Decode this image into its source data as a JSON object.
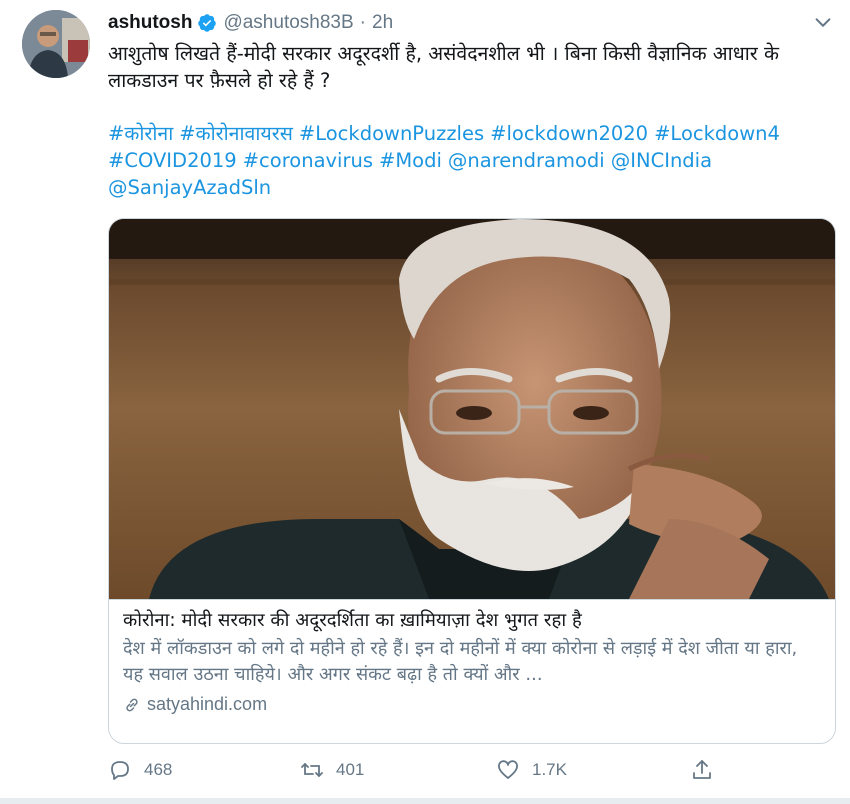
{
  "user": {
    "name": "ashutosh",
    "handle": "@ashutosh83B",
    "separator": "·",
    "time": "2h"
  },
  "tweet": {
    "text": "आशुतोष लिखते हैं-मोदी सरकार अदूरदर्शी है, असंवेदनशील भी । बिना किसी वैज्ञानिक आधार के लाकडाउन पर फ़ैसले हो रहे हैं ?",
    "hashtags": [
      "#कोरोना",
      "#कोरोनावायरस",
      "#LockdownPuzzles",
      "#lockdown2020",
      "#Lockdown4",
      "#COVID2019",
      "#coronavirus",
      "#Modi",
      "@narendramodi",
      "@INCIndia",
      "@SanjayAzadSln"
    ]
  },
  "card": {
    "title": "कोरोना: मोदी सरकार की अदूरदर्शिता का ख़ामियाज़ा देश भुगत रहा है",
    "description": "देश में लॉकडाउन को लगे दो महीने हो रहे हैं। इन दो महीनों में क्या कोरोना से लड़ाई में देश जीता या हारा, यह सवाल उठना चाहिये। और अगर संकट बढ़ा है तो क्यों और ...",
    "domain": "satyahindi.com"
  },
  "actions": {
    "replies": "468",
    "retweets": "401",
    "likes": "1.7K"
  },
  "colors": {
    "link": "#1b95e0",
    "muted": "#657786",
    "verified": "#1da1f2",
    "border": "#ccd6dd"
  }
}
